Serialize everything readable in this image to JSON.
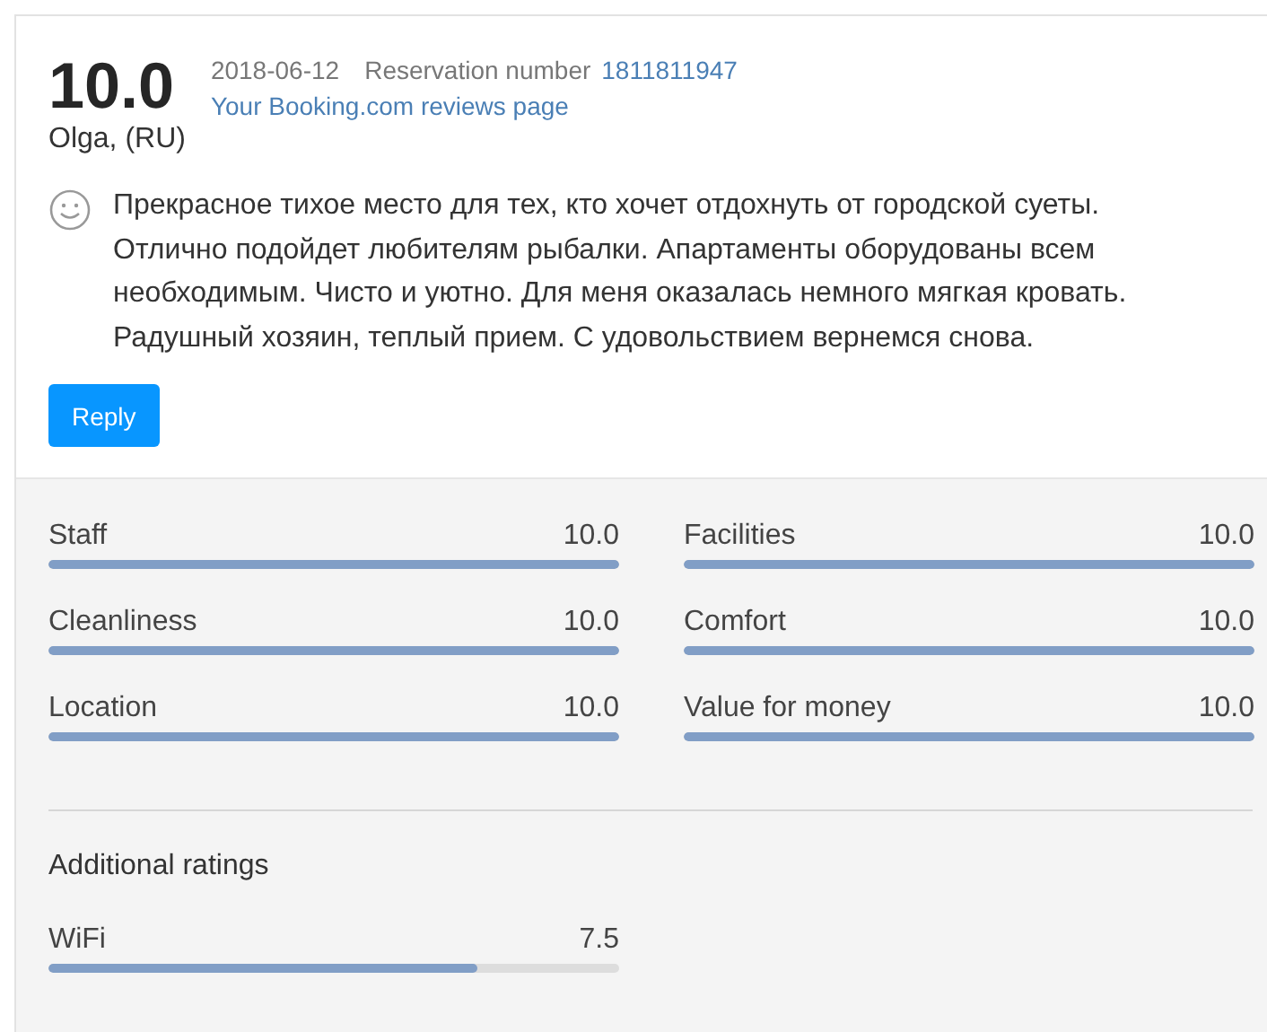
{
  "review": {
    "score": "10.0",
    "date": "2018-06-12",
    "reservation_label": "Reservation number",
    "reservation_number": "1811811947",
    "reviews_link": "Your Booking.com reviews page",
    "author": "Olga, (RU)",
    "text": "Прекрасное тихое место для тех, кто хочет отдохнуть от городской суеты. Отлично подойдет любителям рыбалки. Апартаменты оборудованы всем необходимым. Чисто и уютно. Для меня оказалась немного мягкая кровать. Радушный хозяин, теплый прием. С удовольствием вернемся снова.",
    "reply_button": "Reply"
  },
  "ratings": [
    {
      "label": "Staff",
      "value": "10.0",
      "level": 1
    },
    {
      "label": "Facilities",
      "value": "10.0",
      "level": 1
    },
    {
      "label": "Cleanliness",
      "value": "10.0",
      "level": 1
    },
    {
      "label": "Comfort",
      "value": "10.0",
      "level": 1
    },
    {
      "label": "Location",
      "value": "10.0",
      "level": 1
    },
    {
      "label": "Value for money",
      "value": "10.0",
      "level": 1
    }
  ],
  "additional": {
    "title": "Additional ratings",
    "ratings": [
      {
        "label": "WiFi",
        "value": "7.5",
        "level": 0.75
      }
    ]
  }
}
